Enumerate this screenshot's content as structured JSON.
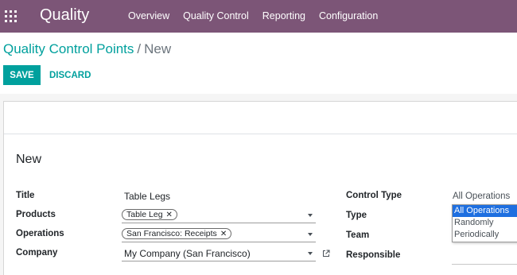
{
  "navbar": {
    "brand": "Quality",
    "menu": [
      "Overview",
      "Quality Control",
      "Reporting",
      "Configuration"
    ]
  },
  "breadcrumb": {
    "parent": "Quality Control Points",
    "separator": "/",
    "current": "New"
  },
  "buttons": {
    "save": "SAVE",
    "discard": "DISCARD"
  },
  "form": {
    "heading": "New",
    "labels": {
      "title": "Title",
      "products": "Products",
      "operations": "Operations",
      "company": "Company",
      "control_type": "Control Type",
      "type": "Type",
      "team": "Team",
      "responsible": "Responsible"
    },
    "values": {
      "title": "Table Legs",
      "products_tags": [
        "Table Leg"
      ],
      "operations_tags": [
        "San Francisco: Receipts"
      ],
      "company": "My Company (San Francisco)",
      "control_type": "All Operations"
    },
    "control_type_options": [
      "All Operations",
      "Randomly",
      "Periodically"
    ],
    "control_type_selected": "All Operations"
  },
  "icons": {
    "apps": "apps-grid-icon",
    "tag_remove": "close-icon",
    "dropdown": "caret-down-icon",
    "external_link": "external-link-icon"
  },
  "colors": {
    "navbar": "#7c5577",
    "accent": "#00a09d",
    "selection": "#1e6fe0"
  }
}
